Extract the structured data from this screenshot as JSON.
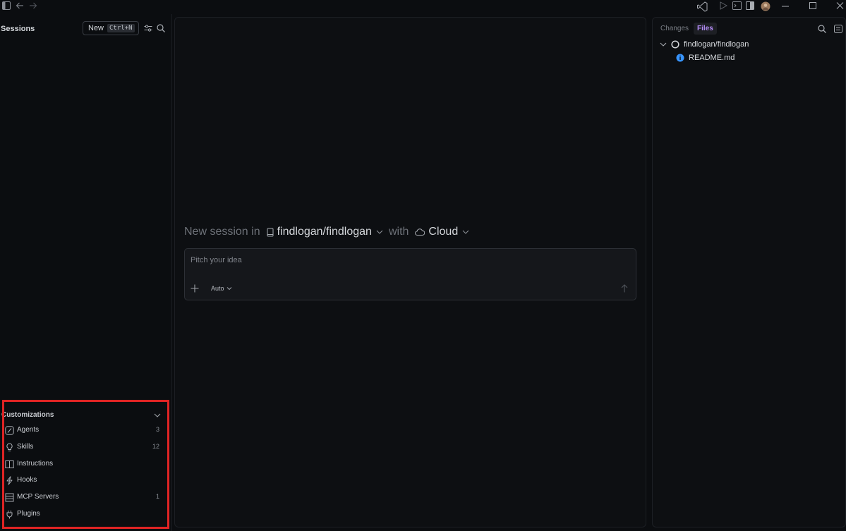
{
  "sessions": {
    "title": "Sessions",
    "new_label": "New",
    "new_shortcut": "Ctrl+N"
  },
  "customizations": {
    "title": "Customizations",
    "items": [
      {
        "label": "Agents",
        "count": "3",
        "icon": "agents-icon"
      },
      {
        "label": "Skills",
        "count": "12",
        "icon": "lightbulb-icon"
      },
      {
        "label": "Instructions",
        "count": "",
        "icon": "book-icon"
      },
      {
        "label": "Hooks",
        "count": "",
        "icon": "lightning-icon"
      },
      {
        "label": "MCP Servers",
        "count": "1",
        "icon": "server-icon"
      },
      {
        "label": "Plugins",
        "count": "",
        "icon": "plug-icon"
      }
    ]
  },
  "main": {
    "new_session_prefix": "New session in",
    "repo": "findlogan/findlogan",
    "with": "with",
    "target": "Cloud",
    "prompt_placeholder": "Pitch your idea",
    "mode": "Auto"
  },
  "right_panel": {
    "tabs": [
      {
        "label": "Changes",
        "active": false
      },
      {
        "label": "Files",
        "active": true
      }
    ],
    "tree": [
      {
        "label": "findlogan/findlogan",
        "type": "repo"
      },
      {
        "label": "README.md",
        "type": "file"
      }
    ]
  },
  "colors": {
    "accent_files_tab": "#b48cf7",
    "highlight": "#e02424",
    "info_icon": "#3794ff"
  }
}
